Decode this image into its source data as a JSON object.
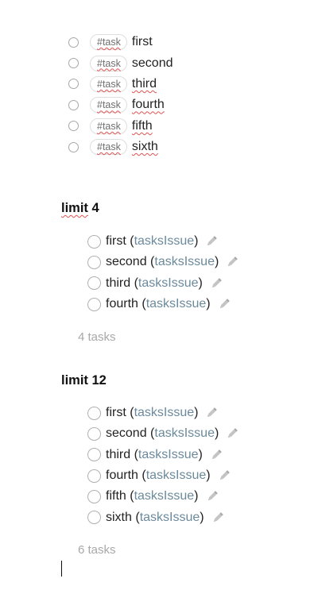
{
  "raw_tasks": {
    "tag_label": "#task",
    "items": [
      {
        "text": "first"
      },
      {
        "text": "second"
      },
      {
        "text": "third"
      },
      {
        "text": "fourth"
      },
      {
        "text": "fifth"
      },
      {
        "text": "sixth"
      }
    ]
  },
  "sections": [
    {
      "heading_keyword": "limit",
      "heading_value": " 4",
      "results": [
        {
          "text": "first",
          "file": "tasksIssue"
        },
        {
          "text": "second",
          "file": "tasksIssue"
        },
        {
          "text": "third",
          "file": "tasksIssue"
        },
        {
          "text": "fourth",
          "file": "tasksIssue"
        }
      ],
      "count_label": "4 tasks"
    },
    {
      "heading_keyword": "limit",
      "heading_value": " 12",
      "results": [
        {
          "text": "first",
          "file": "tasksIssue"
        },
        {
          "text": "second",
          "file": "tasksIssue"
        },
        {
          "text": "third",
          "file": "tasksIssue"
        },
        {
          "text": "fourth",
          "file": "tasksIssue"
        },
        {
          "text": "fifth",
          "file": "tasksIssue"
        },
        {
          "text": "sixth",
          "file": "tasksIssue"
        }
      ],
      "count_label": "6 tasks"
    }
  ],
  "icons": {
    "edit": "pencil-icon",
    "checkbox": "circle-checkbox"
  },
  "colors": {
    "link": "#6b8a9c",
    "muted": "#a8a8a8",
    "spellcheck": "#e05252"
  }
}
